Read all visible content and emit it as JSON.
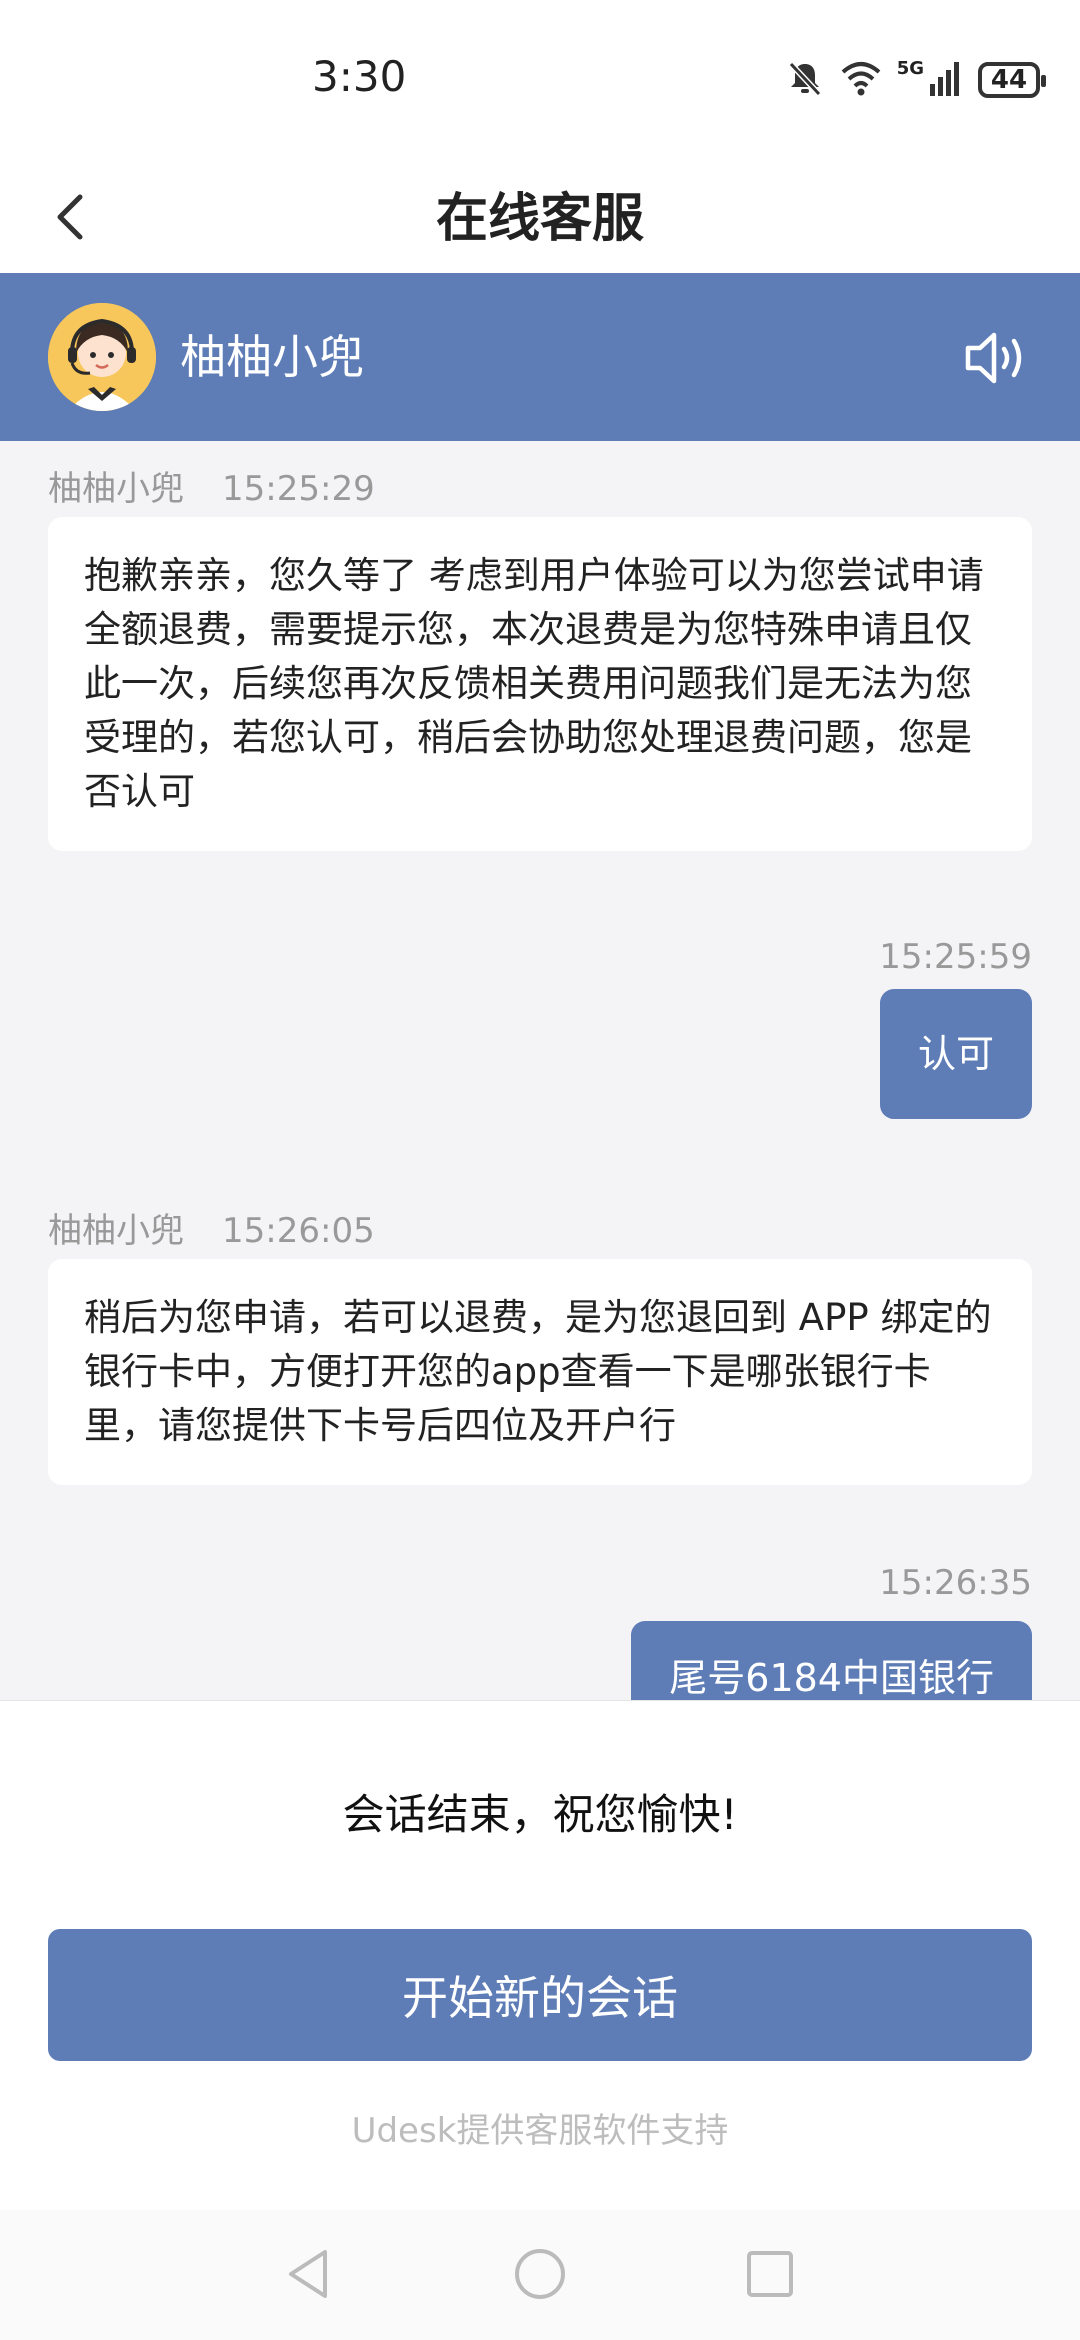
{
  "status_bar": {
    "time": "3:30",
    "network": "5G",
    "battery": "44"
  },
  "header": {
    "title": "在线客服"
  },
  "agent": {
    "name": "柚柚小兜"
  },
  "messages": [
    {
      "sender": "柚柚小兜",
      "time": "15:25:29",
      "text": "抱歉亲亲，您久等了 考虑到用户体验可以为您尝试申请全额退费，需要提示您，本次退费是为您特殊申请且仅此一次，后续您再次反馈相关费用问题我们是无法为您受理的，若您认可，稍后会协助您处理退费问题，您是否认可"
    },
    {
      "sender": "",
      "time": "15:25:59",
      "text": "认可"
    },
    {
      "sender": "柚柚小兜",
      "time": "15:26:05",
      "text": "稍后为您申请，若可以退费，是为您退回到 APP 绑定的银行卡中，方便打开您的app查看一下是哪张银行卡里，请您提供下卡号后四位及开户行"
    },
    {
      "sender": "",
      "time": "15:26:35",
      "text": "尾号6184中国银行"
    }
  ],
  "end_panel": {
    "message": "会话结束，祝您愉快!",
    "new_session_button": "开始新的会话",
    "powered_by": "Udesk提供客服软件支持"
  },
  "colors": {
    "accent": "#5e7db7",
    "background": "#f4f4f6",
    "avatar_bg": "#f7c75c"
  },
  "icons": [
    "mute-bell-icon",
    "wifi-icon",
    "signal-icon",
    "battery-icon",
    "back-arrow-icon",
    "speaker-icon",
    "nav-back-icon",
    "nav-home-icon",
    "nav-recents-icon"
  ]
}
